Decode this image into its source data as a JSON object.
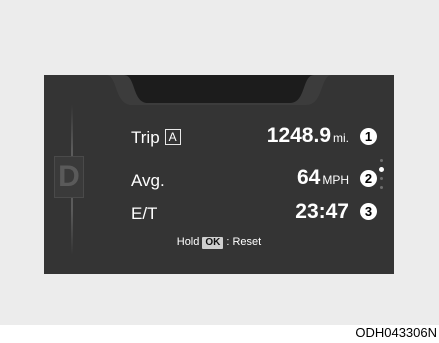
{
  "trip_info": {
    "gear": "D",
    "trip_label": "Trip",
    "trip_letter": "A",
    "distance_value": "1248.9",
    "distance_unit": "mi.",
    "avg_label": "Avg.",
    "avg_speed_value": "64",
    "avg_speed_unit": "MPH",
    "elapsed_label": "E/T",
    "elapsed_value": "23:47"
  },
  "hint": {
    "hold": "Hold",
    "button": "OK",
    "reset": ": Reset"
  },
  "callouts": [
    "1",
    "2",
    "3"
  ],
  "figure_code": "ODH043306N",
  "colors": {
    "screen": "#343434",
    "panel": "#ececec",
    "text": "#ffffff"
  }
}
